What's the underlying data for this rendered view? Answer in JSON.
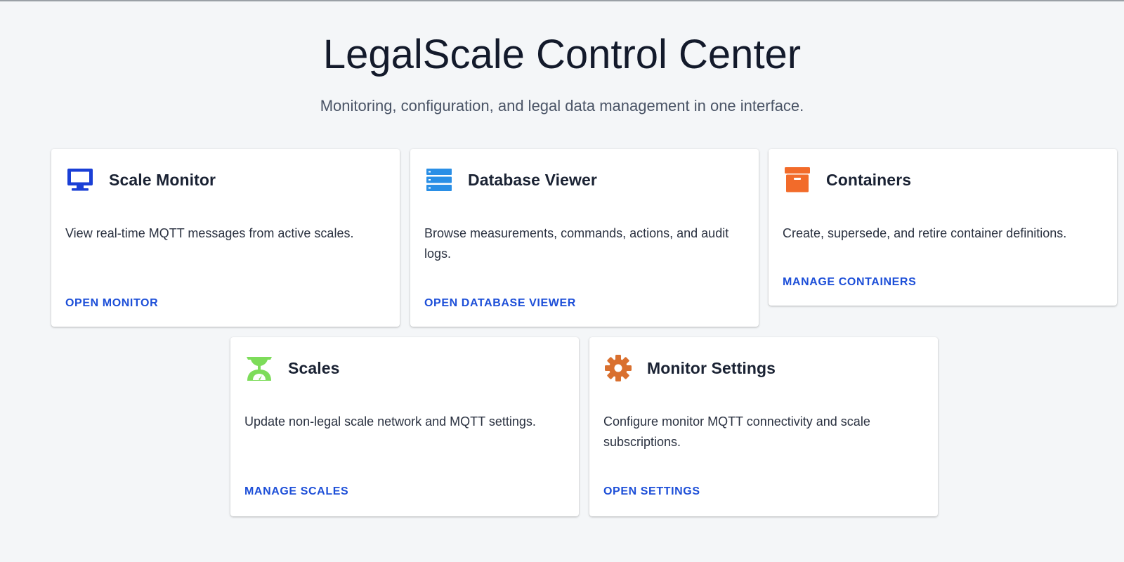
{
  "header": {
    "title": "LegalScale Control Center",
    "subtitle": "Monitoring, configuration, and legal data management in one interface."
  },
  "cards": [
    {
      "title": "Scale Monitor",
      "icon": "monitor-icon",
      "icon_color": "#1a3fd6",
      "description": "View real-time MQTT messages from active scales.",
      "link": "OPEN MONITOR"
    },
    {
      "title": "Database Viewer",
      "icon": "database-icon",
      "icon_color": "#2a8fe6",
      "description": "Browse measurements, commands, actions, and audit logs.",
      "link": "OPEN DATABASE VIEWER"
    },
    {
      "title": "Containers",
      "icon": "archive-box-icon",
      "icon_color": "#f26b2a",
      "description": "Create, supersede, and retire container definitions.",
      "link": "MANAGE CONTAINERS"
    },
    {
      "title": "Scales",
      "icon": "scale-icon",
      "icon_color": "#7ddc5a",
      "description": "Update non-legal scale network and MQTT settings.",
      "link": "MANAGE SCALES"
    },
    {
      "title": "Monitor Settings",
      "icon": "gear-icon",
      "icon_color": "#d9702f",
      "description": "Configure monitor MQTT connectivity and scale subscriptions.",
      "link": "OPEN SETTINGS"
    }
  ]
}
